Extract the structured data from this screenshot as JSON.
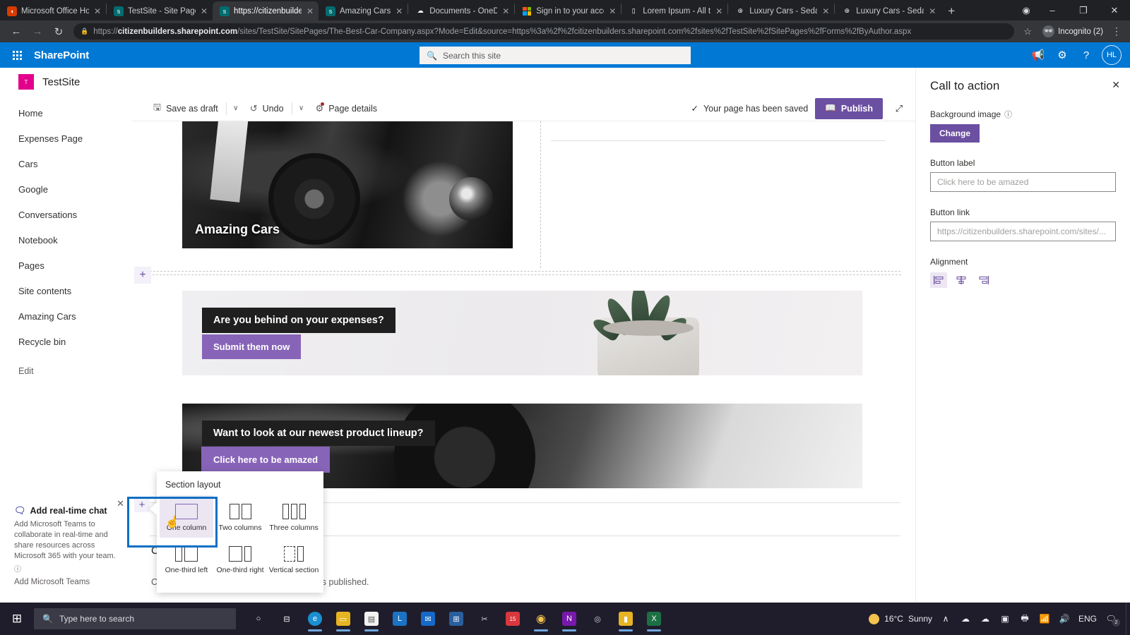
{
  "browser": {
    "tabs": [
      {
        "title": "Microsoft Office Home",
        "favicon": "office-icon",
        "active": false
      },
      {
        "title": "TestSite - Site Pages -",
        "favicon": "sharepoint-icon",
        "active": false
      },
      {
        "title": "https://citizenbuilders",
        "favicon": "sharepoint-icon",
        "active": true
      },
      {
        "title": "Amazing Cars",
        "favicon": "sharepoint-icon",
        "active": false
      },
      {
        "title": "Documents - OneDriv",
        "favicon": "onedrive-icon",
        "active": false
      },
      {
        "title": "Sign in to your accou",
        "favicon": "microsoft-icon",
        "active": false
      },
      {
        "title": "Lorem Ipsum - All the",
        "favicon": "document-icon",
        "active": false
      },
      {
        "title": "Luxury Cars - Sedans,",
        "favicon": "mercedes-icon",
        "active": false
      },
      {
        "title": "Luxury Cars - Sedans,",
        "favicon": "mercedes-icon",
        "active": false
      }
    ],
    "new_tab_label": "+",
    "window_controls": {
      "minimize": "–",
      "maximize": "❐",
      "close": "✕"
    },
    "back_label": "←",
    "forward_label": "→",
    "reload_label": "↻",
    "url_domain": "citizenbuilders.sharepoint.com",
    "url_prefix": "https://",
    "url_path": "/sites/TestSite/SitePages/The-Best-Car-Company.aspx?Mode=Edit&source=https%3a%2f%2fcitizenbuilders.sharepoint.com%2fsites%2fTestSite%2fSitePages%2fForms%2fByAuthor.aspx",
    "star_label": "☆",
    "profile_label": "Incognito (2)",
    "menu_label": "⋮"
  },
  "suite": {
    "brand": "SharePoint",
    "search_placeholder": "Search this site",
    "icons": [
      "megaphone-icon",
      "gear-icon",
      "help-icon"
    ],
    "avatar_initials": "HL"
  },
  "site": {
    "logo_initial": "T",
    "title": "TestSite"
  },
  "sidebar": {
    "items": [
      {
        "label": "Home"
      },
      {
        "label": "Expenses Page"
      },
      {
        "label": "Cars"
      },
      {
        "label": "Google"
      },
      {
        "label": "Conversations"
      },
      {
        "label": "Notebook"
      },
      {
        "label": "Pages"
      },
      {
        "label": "Site contents"
      },
      {
        "label": "Amazing Cars"
      },
      {
        "label": "Recycle bin"
      }
    ],
    "edit_label": "Edit"
  },
  "teams_promo": {
    "title": "Add real-time chat",
    "body": "Add Microsoft Teams to collaborate in real-time and share resources across Microsoft 365 with your team.",
    "info_icon": "info-icon",
    "link_label": "Add Microsoft Teams",
    "close_label": "✕"
  },
  "command_bar": {
    "save_label": "Save as draft",
    "save_icon": "save-icon",
    "save_caret": "∨",
    "undo_label": "Undo",
    "undo_icon": "undo-icon",
    "undo_caret": "∨",
    "page_details_label": "Page details",
    "page_details_icon": "gear-icon",
    "saved_message": "Your page has been saved",
    "saved_check": "✓",
    "publish_label": "Publish",
    "publish_icon": "publish-icon",
    "expand_icon": "expand-icon"
  },
  "canvas": {
    "hero": {
      "caption": "Amazing Cars",
      "image_alt": "classic-car-photo"
    },
    "add_section_plus": "+",
    "banners": [
      {
        "name": "expenses-banner",
        "headline": "Are you behind on your expenses?",
        "cta_label": "Submit them now",
        "image_alt": "succulent-plant-photo"
      },
      {
        "name": "product-banner",
        "headline": "Want to look at our newest product lineup?",
        "cta_label": "Click here to be amazed",
        "image_alt": "car-wheel-photo"
      }
    ],
    "comments_heading": "Comments",
    "comments_note": "Comments will be turned on after the page is published.",
    "scroll_up": "▲",
    "scroll_down": "▼"
  },
  "section_layout_flyout": {
    "title": "Section layout",
    "options": [
      {
        "label": "One column",
        "glyph": "one-column-icon",
        "selected": true
      },
      {
        "label": "Two columns",
        "glyph": "two-columns-icon",
        "selected": false
      },
      {
        "label": "Three columns",
        "glyph": "three-columns-icon",
        "selected": false
      },
      {
        "label": "One-third left",
        "glyph": "one-third-left-icon",
        "selected": false
      },
      {
        "label": "One-third right",
        "glyph": "one-third-right-icon",
        "selected": false
      },
      {
        "label": "Vertical section",
        "glyph": "vertical-section-icon",
        "selected": false
      }
    ],
    "add_button_label": "+"
  },
  "property_pane": {
    "title": "Call to action",
    "close_label": "✕",
    "background_image_label": "Background image",
    "background_info_icon": "info-icon",
    "change_button_label": "Change",
    "button_label_label": "Button label",
    "button_label_value": "Click here to be amazed",
    "button_link_label": "Button link",
    "button_link_value": "https://citizenbuilders.sharepoint.com/sites/...",
    "alignment_label": "Alignment",
    "alignment_options": [
      {
        "name": "align-left-icon",
        "active": true
      },
      {
        "name": "align-center-icon",
        "active": false
      },
      {
        "name": "align-right-icon",
        "active": false
      }
    ]
  },
  "taskbar": {
    "start_icon": "windows-icon",
    "search_placeholder": "Type here to search",
    "search_icon": "search-icon",
    "pinned": [
      {
        "name": "cortana-icon",
        "glyph": "○",
        "color": "#ffffff",
        "bg": "transparent"
      },
      {
        "name": "task-view-icon",
        "glyph": "⌸",
        "color": "#ffffff",
        "bg": "transparent"
      },
      {
        "name": "edge-icon",
        "glyph": "e",
        "color": "#ffffff",
        "bg": "#1a8fd1"
      },
      {
        "name": "file-explorer-icon",
        "glyph": "▭",
        "color": "#ffffff",
        "bg": "#e6b422"
      },
      {
        "name": "store-icon",
        "glyph": "▤",
        "color": "#ffffff",
        "bg": "#f2f2f2"
      },
      {
        "name": "lumin-icon",
        "glyph": "L",
        "color": "#ffffff",
        "bg": "#1b73c4"
      },
      {
        "name": "mail-icon",
        "glyph": "✉",
        "color": "#ffffff",
        "bg": "#1769c7"
      },
      {
        "name": "calculator-icon",
        "glyph": "⊞",
        "color": "#ffffff",
        "bg": "#2a5f9e"
      },
      {
        "name": "snip-tool-icon",
        "glyph": "✂",
        "color": "#ffffff",
        "bg": "transparent"
      },
      {
        "name": "todoist-icon",
        "glyph": "15",
        "color": "#ffffff",
        "bg": "#d8373d"
      },
      {
        "name": "chrome-icon",
        "glyph": "◉",
        "color": "#ffffff",
        "bg": "transparent"
      },
      {
        "name": "onenote-icon",
        "glyph": "N",
        "color": "#ffffff",
        "bg": "#7719aa"
      },
      {
        "name": "chrome-alt-icon",
        "glyph": "◎",
        "color": "#cfcfd8",
        "bg": "transparent"
      },
      {
        "name": "folder-icon",
        "glyph": "▮",
        "color": "#ffffff",
        "bg": "#e6b422"
      },
      {
        "name": "excel-icon",
        "glyph": "X",
        "color": "#ffffff",
        "bg": "#1d7044"
      }
    ],
    "weather_temp": "16°C",
    "weather_desc": "Sunny",
    "tray_caret": "∧",
    "tray_icons": [
      "cloud-icon",
      "onedrive-icon",
      "outlook-icon",
      "printer-icon",
      "wifi-icon",
      "volume-icon"
    ],
    "language": "ENG",
    "notification_icon": "notification-icon",
    "notification_count": "2"
  },
  "colors": {
    "sharepoint_blue": "#0078d4",
    "publish_purple": "#6b4fa1",
    "cta_purple": "#8764b8",
    "site_logo_pink": "#e3008c",
    "selection_blue": "#0b6fc4"
  }
}
